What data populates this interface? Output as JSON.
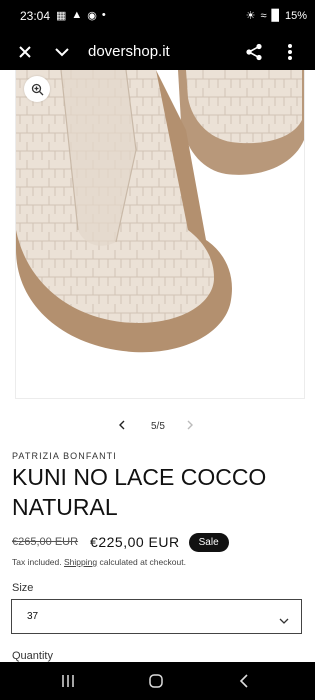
{
  "status_bar": {
    "time": "23:04",
    "battery": "15%"
  },
  "browser": {
    "url": "dovershop.it"
  },
  "product": {
    "vendor": "PATRIZIA BONFANTI",
    "title": "KUNI NO LACE COCCO NATURAL",
    "old_price": "€265,00 EUR",
    "new_price": "€225,00 EUR",
    "badge": "Sale",
    "tax_prefix": "Tax included.",
    "shipping_link": "Shipping",
    "tax_suffix": "calculated at checkout."
  },
  "gallery": {
    "counter": "5/5"
  },
  "size": {
    "label": "Size",
    "selected": "37"
  },
  "quantity": {
    "label": "Quantity"
  },
  "colors": {
    "shoe_leather": "#e8ddd3",
    "sole": "#b8987a",
    "badge_bg": "#111111"
  }
}
